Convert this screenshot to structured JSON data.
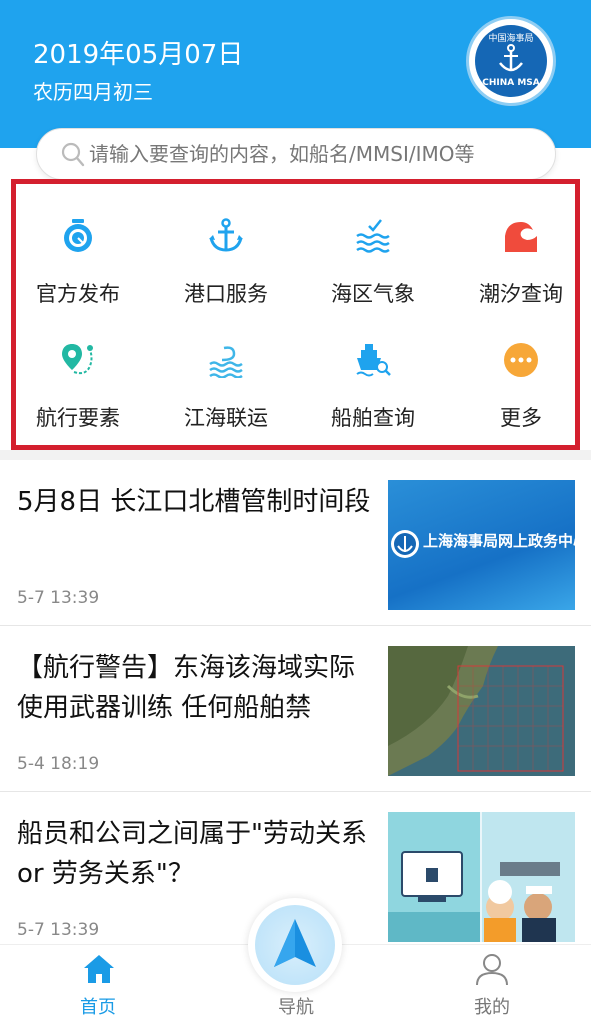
{
  "header": {
    "date": "2019年05月07日",
    "lunar": "农历四月初三",
    "logo_top_text": "中国海事局",
    "logo_bottom_text": "CHINA MSA"
  },
  "search": {
    "placeholder": "请输入要查询的内容，如船名/MMSI/IMO等"
  },
  "menu": [
    {
      "label": "官方发布",
      "icon": "official-release-icon"
    },
    {
      "label": "港口服务",
      "icon": "anchor-icon"
    },
    {
      "label": "海区气象",
      "icon": "sea-weather-icon"
    },
    {
      "label": "潮汐查询",
      "icon": "tide-icon"
    },
    {
      "label": "航行要素",
      "icon": "navigation-pin-icon"
    },
    {
      "label": "江海联运",
      "icon": "river-sea-icon"
    },
    {
      "label": "船舶查询",
      "icon": "ship-search-icon"
    },
    {
      "label": "更多",
      "icon": "more-icon"
    }
  ],
  "news": [
    {
      "title": "5月8日 长江口北槽管制时间段",
      "time": "5-7 13:39",
      "thumb_text": "上海海事局网上政务中心"
    },
    {
      "title": "【航行警告】东海该海域实际使用武器训练 任何船舶禁",
      "time": "5-4 18:19"
    },
    {
      "title": "船员和公司之间属于\"劳动关系 or 劳务关系\"？",
      "time": "5-7 13:39"
    }
  ],
  "tabs": [
    {
      "label": "首页",
      "active": true
    },
    {
      "label": "导航",
      "active": false
    },
    {
      "label": "我的",
      "active": false
    }
  ],
  "colors": {
    "primary": "#1fa3ee",
    "highlight_border": "#d41f2e",
    "tab_active": "#1a9be6",
    "tab_inactive": "#777777"
  }
}
